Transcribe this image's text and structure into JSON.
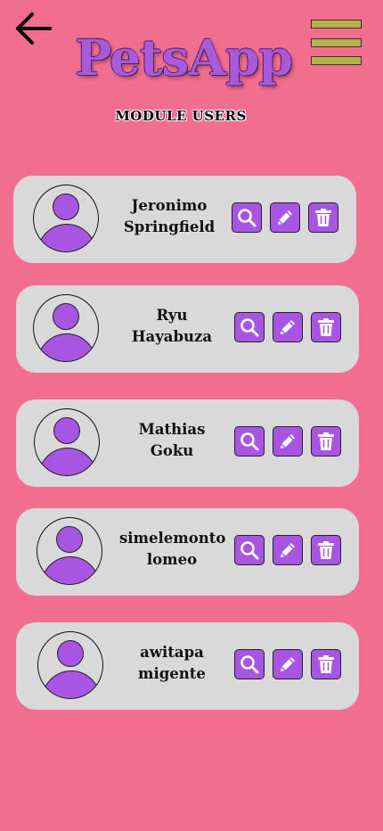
{
  "header": {
    "app_title": "PetsApp",
    "subtitle": "MODULE USERS",
    "back_icon": "arrow-left-icon",
    "menu_icon": "hamburger-menu-icon"
  },
  "colors": {
    "background": "#f26e8f",
    "card": "#d9d9d9",
    "accent": "#a855e3",
    "menu_bars": "#b5b04a"
  },
  "users": [
    {
      "name": "Jeronimo\nSpringfield"
    },
    {
      "name": "Ryu\nHayabuza"
    },
    {
      "name": "Mathias\nGoku"
    },
    {
      "name": "simelemonto\nlomeo"
    },
    {
      "name": "awitapa\nmigente"
    }
  ],
  "actions": [
    "search-icon",
    "edit-pencil-icon",
    "trash-icon"
  ]
}
